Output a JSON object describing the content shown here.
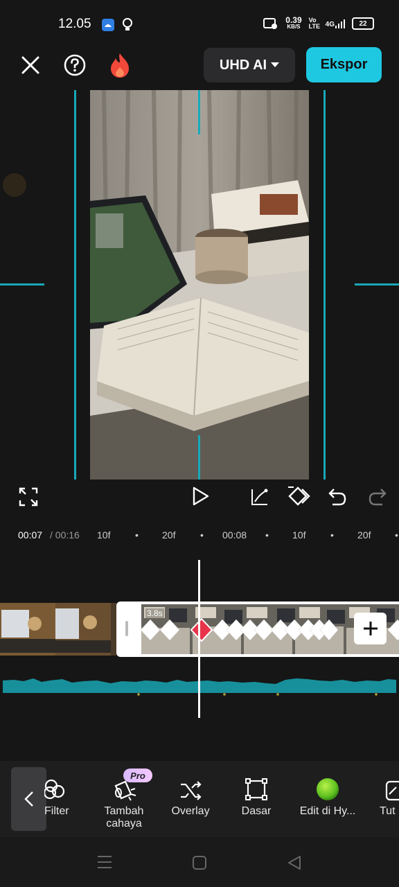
{
  "status_bar": {
    "time": "12.05",
    "speed_value": "0.39",
    "speed_unit": "KB/S",
    "net_label": "Vo LTE",
    "signal_label": "4G",
    "battery": "22"
  },
  "header": {
    "quality_label": "UHD AI",
    "export_label": "Ekspor"
  },
  "ruler": {
    "current_time": "00:07",
    "total_time": "/ 00:16",
    "ticks": [
      "10f",
      "•",
      "20f",
      "•",
      "00:08",
      "•",
      "10f",
      "•",
      "20f",
      "•"
    ]
  },
  "timeline": {
    "clip_duration": "3.8s"
  },
  "toolbar": {
    "items": [
      {
        "label": "Filter",
        "icon": "filter-icon"
      },
      {
        "label": "Tambah cahaya",
        "icon": "lighting-icon",
        "badge": "Pro"
      },
      {
        "label": "Overlay",
        "icon": "shuffle-icon"
      },
      {
        "label": "Dasar",
        "icon": "crop-square-icon"
      },
      {
        "label": "Edit di Hy...",
        "icon": "green-orb-icon"
      },
      {
        "label": "Tut",
        "icon": "partial-icon"
      }
    ]
  },
  "colors": {
    "accent": "#1fc8e1",
    "guide": "#19a9b9",
    "waveform": "#17909c",
    "keyframe_active": "#e8344a"
  }
}
